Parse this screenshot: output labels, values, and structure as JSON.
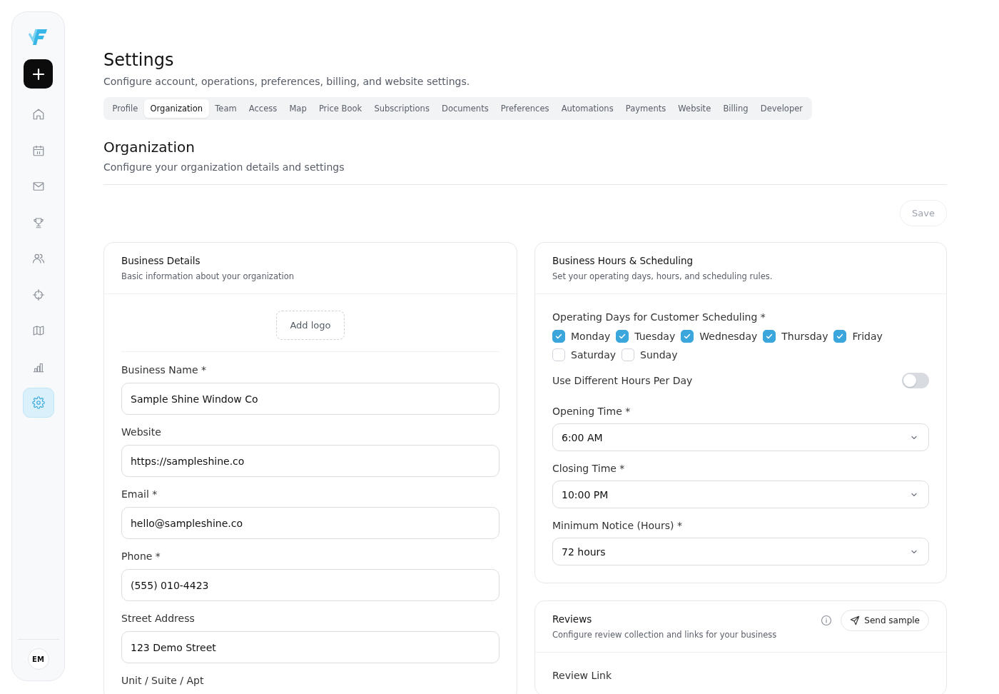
{
  "sidebar": {
    "items": [
      {
        "selected": false
      },
      {
        "selected": false
      },
      {
        "selected": false
      },
      {
        "selected": false
      },
      {
        "selected": false
      },
      {
        "selected": false
      },
      {
        "selected": false
      },
      {
        "selected": false
      },
      {
        "selected": true
      }
    ],
    "avatar": "EM"
  },
  "page": {
    "title": "Settings",
    "subtitle": "Configure account, operations, preferences, billing, and website settings."
  },
  "tabs": [
    {
      "label": "Profile",
      "selected": false
    },
    {
      "label": "Organization",
      "selected": true
    },
    {
      "label": "Team",
      "selected": false
    },
    {
      "label": "Access",
      "selected": false
    },
    {
      "label": "Map",
      "selected": false
    },
    {
      "label": "Price Book",
      "selected": false
    },
    {
      "label": "Subscriptions",
      "selected": false
    },
    {
      "label": "Documents",
      "selected": false
    },
    {
      "label": "Preferences",
      "selected": false
    },
    {
      "label": "Automations",
      "selected": false
    },
    {
      "label": "Payments",
      "selected": false
    },
    {
      "label": "Website",
      "selected": false
    },
    {
      "label": "Billing",
      "selected": false
    },
    {
      "label": "Developer",
      "selected": false
    }
  ],
  "section": {
    "title": "Organization",
    "subtitle": "Configure your organization details and settings",
    "save": "Save"
  },
  "business_details": {
    "title": "Business Details",
    "subtitle": "Basic information about your organization",
    "logo_button": "Add logo",
    "fields": [
      {
        "label": "Business Name *",
        "value": "Sample Shine Window Co"
      },
      {
        "label": "Website",
        "value": "https://sampleshine.co"
      },
      {
        "label": "Email *",
        "value": "hello@sampleshine.co"
      },
      {
        "label": "Phone *",
        "value": "(555) 010-4423"
      },
      {
        "label": "Street Address",
        "value": "123 Demo Street"
      }
    ],
    "cut_label": "Unit / Suite / Apt"
  },
  "business_hours": {
    "title": "Business Hours & Scheduling",
    "subtitle": "Set your operating days, hours, and scheduling rules.",
    "days_label": "Operating Days for Customer Scheduling *",
    "days": [
      {
        "label": "Monday",
        "checked": true
      },
      {
        "label": "Tuesday",
        "checked": true
      },
      {
        "label": "Wednesday",
        "checked": true
      },
      {
        "label": "Thursday",
        "checked": true
      },
      {
        "label": "Friday",
        "checked": true
      },
      {
        "label": "Saturday",
        "checked": false
      },
      {
        "label": "Sunday",
        "checked": false
      }
    ],
    "toggle": {
      "label": "Use Different Hours Per Day",
      "on": false
    },
    "selects": [
      {
        "label": "Opening Time *",
        "value": "6:00 AM"
      },
      {
        "label": "Closing Time *",
        "value": "10:00 PM"
      },
      {
        "label": "Minimum Notice (Hours) *",
        "value": "72 hours"
      }
    ]
  },
  "reviews": {
    "title": "Reviews",
    "subtitle": "Configure review collection and links for your business",
    "send_button": "Send sample",
    "field_label": "Review Link"
  }
}
